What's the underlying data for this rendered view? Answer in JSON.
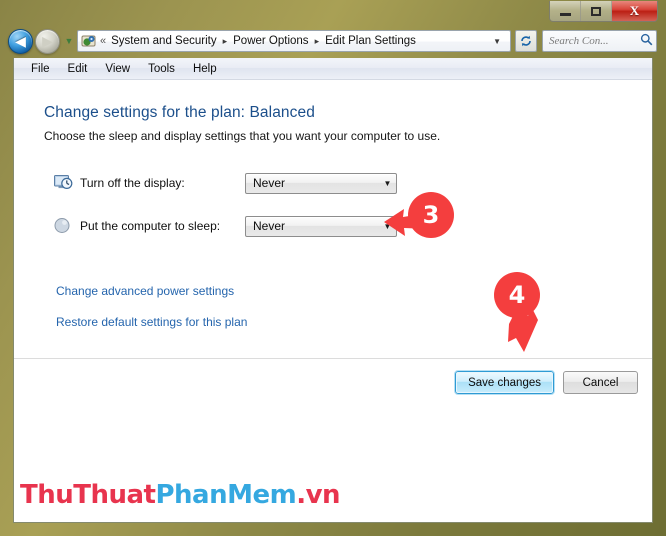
{
  "window": {
    "controls": {
      "minimize_label": "—",
      "maximize_label": "□",
      "close_label": "X"
    }
  },
  "nav": {
    "back_icon": "◀",
    "back_name": "back-button",
    "forward_icon": "▶",
    "history_caret": "▼",
    "address_icon": "control-panel-icon",
    "chevron_prev": "«",
    "breadcrumbs": [
      {
        "label": "System and Security"
      },
      {
        "label": "Power Options"
      },
      {
        "label": "Edit Plan Settings"
      }
    ],
    "crumb_separator": "▸",
    "address_caret": "▼",
    "refresh_icon": "↻",
    "search_placeholder": "Search Con...",
    "search_value": "",
    "search_icon": "🔍"
  },
  "menubar": {
    "items": [
      {
        "label": "File"
      },
      {
        "label": "Edit"
      },
      {
        "label": "View"
      },
      {
        "label": "Tools"
      },
      {
        "label": "Help"
      }
    ]
  },
  "page": {
    "title": "Change settings for the plan: Balanced",
    "subtitle": "Choose the sleep and display settings that you want your computer to use."
  },
  "settings": [
    {
      "icon": "monitor-clock-icon",
      "label": "Turn off the display:",
      "value": "Never",
      "caret": "▼"
    },
    {
      "icon": "sleep-moon-icon",
      "label": "Put the computer to sleep:",
      "value": "Never",
      "caret": "▼"
    }
  ],
  "links": [
    {
      "label": "Change advanced power settings"
    },
    {
      "label": "Restore default settings for this plan"
    }
  ],
  "buttons": {
    "save_label": "Save changes",
    "cancel_label": "Cancel"
  },
  "annotations": [
    {
      "number": "3",
      "color": "#f43e3e",
      "points_to": "sleep-combo"
    },
    {
      "number": "4",
      "color": "#f43e3e",
      "points_to": "save-changes-button"
    }
  ],
  "watermark": {
    "part1": "ThuThuat",
    "part2": "PhanMem",
    "part3": ".vn",
    "color1": "#e8344e",
    "color2": "#35a8e0"
  },
  "colors": {
    "frame": "#8f8a48",
    "link": "#2565ad",
    "title": "#1c4f8b",
    "accent_red": "#f43e3e"
  }
}
